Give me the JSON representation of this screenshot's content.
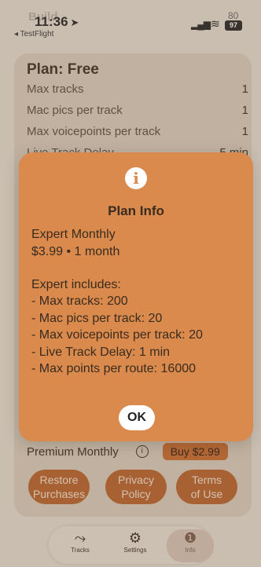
{
  "status": {
    "build_label": "Build",
    "time": "11:36",
    "back_app": "◂ TestFlight",
    "battery": "97",
    "battery_top": "80"
  },
  "plan": {
    "title": "Plan: Free",
    "rows": [
      {
        "label": "Max tracks",
        "value": "1"
      },
      {
        "label": "Mac pics per track",
        "value": "1"
      },
      {
        "label": "Max voicepoints per track",
        "value": "1"
      },
      {
        "label": "Live Track Delay",
        "value": "5 min"
      }
    ]
  },
  "premium": {
    "label": "Premium Monthly",
    "info_icon": "ⓘ",
    "buy_label": "Buy $2.99"
  },
  "actions": [
    {
      "line1": "Restore",
      "line2": "Purchases"
    },
    {
      "line1": "Privacy",
      "line2": "Policy"
    },
    {
      "line1": "Terms",
      "line2": "of Use"
    }
  ],
  "tabs": [
    {
      "label": "Tracks",
      "icon": "route-icon"
    },
    {
      "label": "Settings",
      "icon": "gear-icon"
    },
    {
      "label": "Info",
      "icon": "info-icon"
    }
  ],
  "modal": {
    "title": "Plan Info",
    "plan_name": "Expert Monthly",
    "price": "$3.99 • 1 month",
    "includes_heading": "Expert includes:",
    "features": [
      "- Max tracks: 200",
      "- Mac pics per track: 20",
      "- Max voicepoints per track: 20",
      "- Live Track Delay: 1 min",
      "- Max points per route: 16000"
    ],
    "ok_label": "OK"
  },
  "colors": {
    "modal_bg": "#d98a4c",
    "accent": "#b8602a"
  }
}
